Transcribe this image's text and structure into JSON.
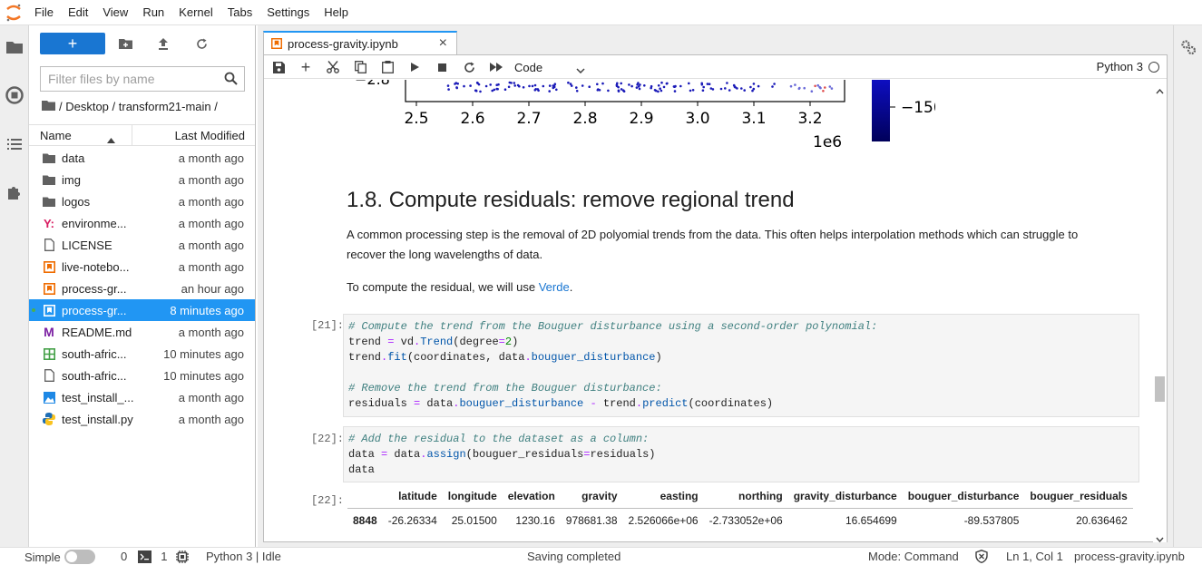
{
  "menubar": {
    "items": [
      "File",
      "Edit",
      "View",
      "Run",
      "Kernel",
      "Tabs",
      "Settings",
      "Help"
    ]
  },
  "filebrowser": {
    "filter_placeholder": "Filter files by name",
    "breadcrumb": "/ Desktop / transform21-main /",
    "header": {
      "name": "Name",
      "modified": "Last Modified"
    },
    "files": [
      {
        "name": "data",
        "modified": "a month ago",
        "icon": "folder-icon"
      },
      {
        "name": "img",
        "modified": "a month ago",
        "icon": "folder-icon"
      },
      {
        "name": "logos",
        "modified": "a month ago",
        "icon": "folder-icon"
      },
      {
        "name": "environme...",
        "modified": "a month ago",
        "icon": "yaml-icon"
      },
      {
        "name": "LICENSE",
        "modified": "a month ago",
        "icon": "file-icon"
      },
      {
        "name": "live-notebo...",
        "modified": "a month ago",
        "icon": "notebook-icon"
      },
      {
        "name": "process-gr...",
        "modified": "an hour ago",
        "icon": "notebook-icon"
      },
      {
        "name": "process-gr...",
        "modified": "8 minutes ago",
        "icon": "notebook-icon",
        "selected": true
      },
      {
        "name": "README.md",
        "modified": "a month ago",
        "icon": "markdown-icon"
      },
      {
        "name": "south-afric...",
        "modified": "10 minutes ago",
        "icon": "spreadsheet-icon"
      },
      {
        "name": "south-afric...",
        "modified": "10 minutes ago",
        "icon": "file-icon"
      },
      {
        "name": "test_install_...",
        "modified": "a month ago",
        "icon": "image-icon"
      },
      {
        "name": "test_install.py",
        "modified": "a month ago",
        "icon": "python-icon"
      }
    ]
  },
  "tab": {
    "title": "process-gravity.ipynb"
  },
  "toolbar": {
    "cell_type": "Code",
    "kernel": "Python 3"
  },
  "plot": {
    "y_tick": "−2.8",
    "x_ticks": [
      "2.5",
      "2.6",
      "2.7",
      "2.8",
      "2.9",
      "3.0",
      "3.1",
      "3.2"
    ],
    "x_offset": "1e6",
    "colorbar_tick": "−150"
  },
  "notebook": {
    "heading": "1.8. Compute residuals: remove regional trend",
    "para1": "A common processing step is the removal of 2D polyomial trends from the data. This often helps interpolation methods which can struggle to recover the long wavelengths of data.",
    "para2_pre": "To compute the residual, we will use ",
    "para2_link": "Verde",
    "para2_post": ".",
    "cell21_prompt": "[21]:",
    "cell22_prompt": "[22]:",
    "out22_prompt": "[22]:",
    "table": {
      "columns": [
        "latitude",
        "longitude",
        "elevation",
        "gravity",
        "easting",
        "northing",
        "gravity_disturbance",
        "bouguer_disturbance",
        "bouguer_residuals"
      ],
      "rows": [
        {
          "index": "8848",
          "values": [
            "-26.26334",
            "25.01500",
            "1230.16",
            "978681.38",
            "2.526066e+06",
            "-2.733052e+06",
            "16.654699",
            "-89.537805",
            "20.636462"
          ]
        }
      ]
    }
  },
  "statusbar": {
    "mode_label": "Simple",
    "terminals": "0",
    "kernels": "1",
    "kernel_status": "Python 3 | Idle",
    "saving": "Saving completed",
    "mode": "Mode: Command",
    "position": "Ln 1, Col 1",
    "filename": "process-gravity.ipynb"
  }
}
